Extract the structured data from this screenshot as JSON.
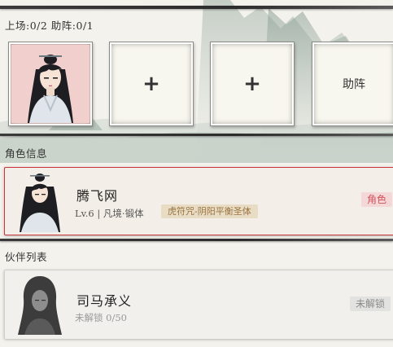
{
  "lineup": {
    "summary": "上场:0/2 助阵:0/1",
    "slots": [
      {
        "type": "character",
        "name": "portrait"
      },
      {
        "type": "empty",
        "symbol": "+"
      },
      {
        "type": "empty",
        "symbol": "+"
      },
      {
        "type": "support",
        "label": "助阵"
      }
    ]
  },
  "character_info": {
    "section_label": "角色信息",
    "name": "腾飞网",
    "level_realm": "Lv.6 | 凡境·锻体",
    "skill_tag": "虎符咒-阴阳平衡圣体",
    "role_badge": "角色"
  },
  "partner_list": {
    "section_label": "伙伴列表",
    "items": [
      {
        "name": "司马承义",
        "progress": "未解锁 0/50",
        "status": "未解锁"
      }
    ]
  },
  "colors": {
    "accent_red": "#c9343d",
    "tag_gold": "#9a7441",
    "badge_red_bg": "#f4d8d8"
  }
}
